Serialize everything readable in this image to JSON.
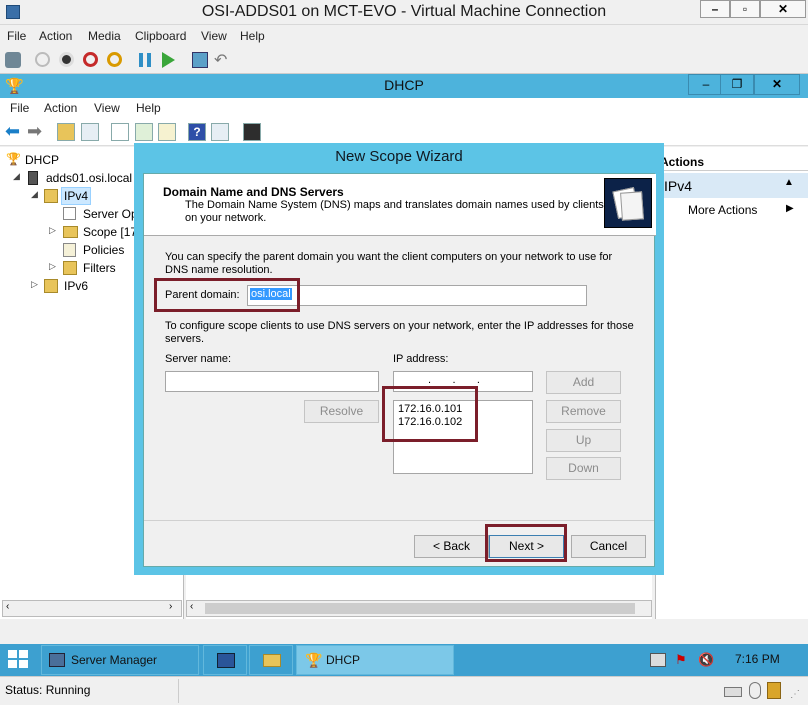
{
  "vm_window": {
    "title": "OSI-ADDS01 on MCT-EVO - Virtual Machine Connection",
    "menu": [
      "File",
      "Action",
      "Media",
      "Clipboard",
      "View",
      "Help"
    ]
  },
  "mmc_window": {
    "title": "DHCP",
    "menu": [
      "File",
      "Action",
      "View",
      "Help"
    ]
  },
  "tree": {
    "items": [
      "DHCP",
      "adds01.osi.local",
      "IPv4",
      "Server Op",
      "Scope [17",
      "Policies",
      "Filters",
      "IPv6"
    ]
  },
  "actions_pane": {
    "header": "Actions",
    "section": "IPv4",
    "more_actions": "More Actions"
  },
  "wizard": {
    "title": "New Scope Wizard",
    "heading": "Domain Name and DNS Servers",
    "description_line1": "The Domain Name System (DNS) maps and translates domain names used by clients",
    "description_line2": "on your network.",
    "intro_line1": "You can specify the parent domain you want the client computers on your network to use for",
    "intro_line2": "DNS name resolution.",
    "parent_domain_label": "Parent domain:",
    "parent_domain_value": "osi.local",
    "config_line1": "To configure scope clients to use DNS servers on your network, enter the IP addresses for those",
    "config_line2": "servers.",
    "server_name_label": "Server name:",
    "ip_address_label": "IP address:",
    "ip_input_dots": ".       .       .",
    "ip_list": [
      "172.16.0.101",
      "172.16.0.102"
    ],
    "buttons": {
      "resolve": "Resolve",
      "add": "Add",
      "remove": "Remove",
      "up": "Up",
      "down": "Down",
      "back": "< Back",
      "next": "Next >",
      "cancel": "Cancel"
    }
  },
  "taskbar": {
    "items": [
      "Server Manager",
      "DHCP"
    ],
    "clock": "7:16 PM"
  },
  "status": {
    "text": "Status: Running"
  },
  "colors": {
    "accent": "#4db3dc",
    "dialog_frame": "#5cc4e6",
    "highlight_box": "#7b1e2a",
    "taskbar": "#3da0d0"
  }
}
